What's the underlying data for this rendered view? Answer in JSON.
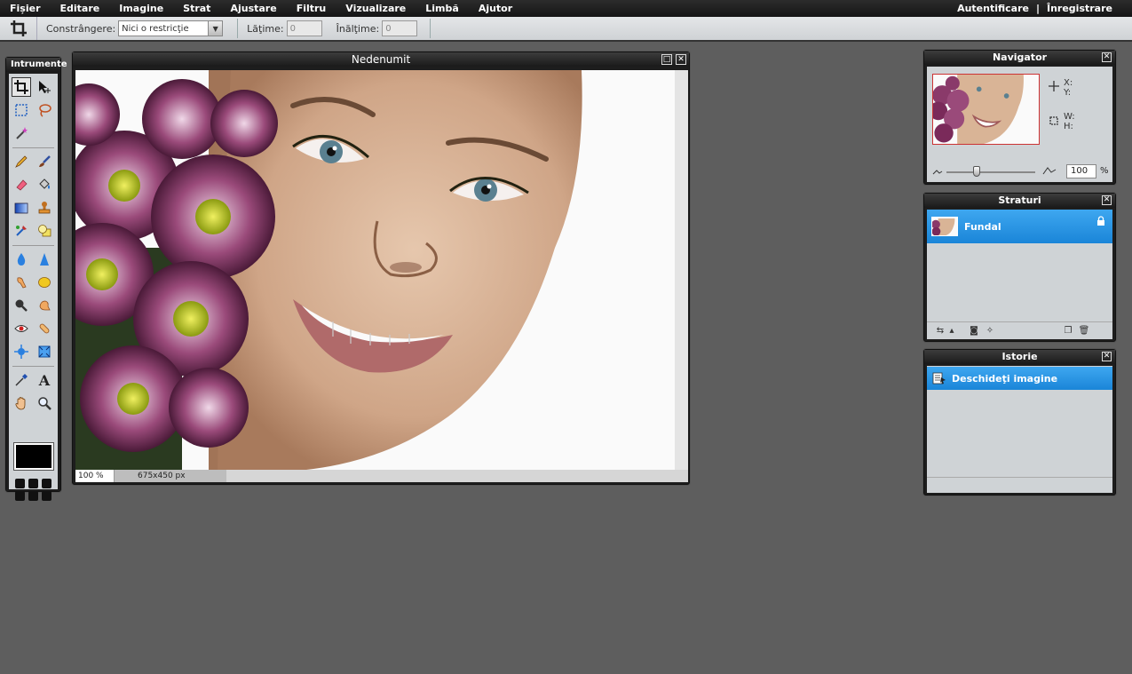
{
  "menubar": {
    "items": [
      "Fișier",
      "Editare",
      "Imagine",
      "Strat",
      "Ajustare",
      "Filtru",
      "Vizualizare",
      "Limbă",
      "Ajutor"
    ],
    "login": "Autentificare",
    "separator": "|",
    "register": "Înregistrare"
  },
  "options": {
    "constraint_label": "Constrângere:",
    "constraint_value": "Nici o restricţie",
    "width_label": "Lăţime:",
    "width_value": "0",
    "height_label": "Înălţime:",
    "height_value": "0"
  },
  "tools": {
    "title": "Intrumente"
  },
  "image_window": {
    "title": "Nedenumit",
    "zoom": "100 %",
    "dimensions": "675x450 px"
  },
  "navigator": {
    "title": "Navigator",
    "x_label": "X:",
    "y_label": "Y:",
    "w_label": "W:",
    "h_label": "H:",
    "zoom_value": "100",
    "zoom_unit": "%"
  },
  "layers": {
    "title": "Straturi",
    "items": [
      {
        "name": "Fundal",
        "locked": true
      }
    ]
  },
  "history": {
    "title": "Istorie",
    "items": [
      {
        "name": "Deschideţi imagine"
      }
    ]
  },
  "colors": {
    "menubar_bg": "#1e1e1e",
    "workspace_bg": "#5e5e5e",
    "selection_blue": "#2896e6",
    "foreground_color": "#000000"
  }
}
